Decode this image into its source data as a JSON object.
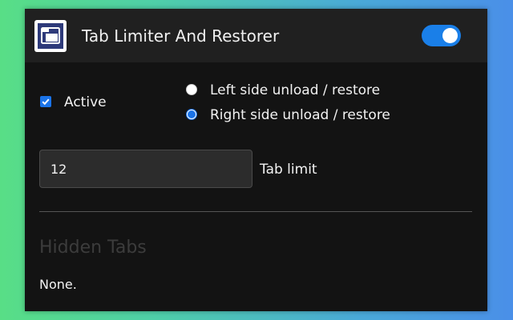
{
  "header": {
    "title": "Tab Limiter And Restorer",
    "app_icon": "window-icon",
    "enabled": true
  },
  "options": {
    "active_label": "Active",
    "active_checked": true,
    "left_label": "Left side unload / restore",
    "right_label": "Right side unload / restore",
    "selected_side": "right"
  },
  "limit": {
    "value": "12",
    "label": "Tab limit"
  },
  "hidden_tabs": {
    "title": "Hidden Tabs",
    "empty_text": "None."
  },
  "colors": {
    "accent": "#1a73e8",
    "toggle": "#1a7fe8",
    "panel_bg": "#131313",
    "header_bg": "#202020"
  }
}
